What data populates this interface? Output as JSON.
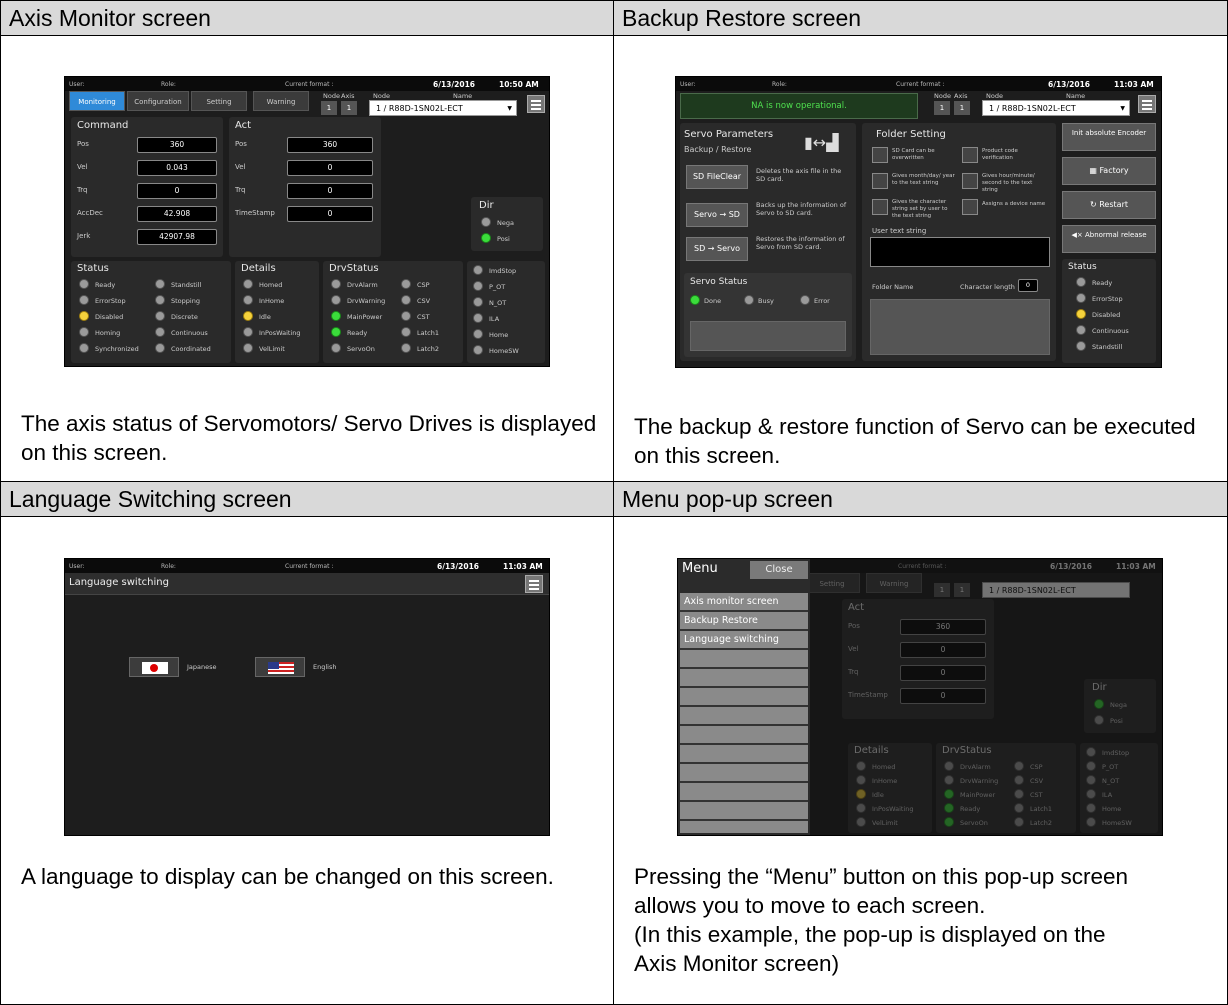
{
  "cells": {
    "axis_monitor": {
      "title": "Axis Monitor screen",
      "caption": "The axis status of Servomotors/ Servo Drives is displayed on this screen."
    },
    "backup_restore": {
      "title": "Backup Restore screen",
      "caption": "The backup & restore function of Servo can be executed on this screen."
    },
    "language": {
      "title": "Language Switching screen",
      "caption": "A language to display can be changed on this screen."
    },
    "menu": {
      "title": "Menu pop-up screen",
      "caption_lines": [
        "Pressing the “Menu” button on this pop-up screen",
        "allows you to move to each screen.",
        "(In this example, the pop-up is displayed on the",
        "Axis Monitor screen)"
      ]
    }
  },
  "hmi": {
    "topbar": {
      "user": "User:",
      "role": "Role:",
      "format": "Current format :"
    },
    "axis": {
      "date": "6/13/2016",
      "time": "10:50 AM",
      "tabs": [
        "Monitoring",
        "Configuration",
        "Setting",
        "Warning"
      ],
      "node_label": "Node",
      "axis_label": "Axis",
      "node2_label": "Node",
      "name_label": "Name",
      "node": "1",
      "axis": "1",
      "name": "1 / R88D-1SN02L-ECT",
      "command": {
        "title": "Command",
        "rows": [
          {
            "k": "Pos",
            "v": "360"
          },
          {
            "k": "Vel",
            "v": "0.043"
          },
          {
            "k": "Trq",
            "v": "0"
          },
          {
            "k": "AccDec",
            "v": "42.908"
          },
          {
            "k": "Jerk",
            "v": "42907.98"
          }
        ]
      },
      "act": {
        "title": "Act",
        "rows": [
          {
            "k": "Pos",
            "v": "360"
          },
          {
            "k": "Vel",
            "v": "0"
          },
          {
            "k": "Trq",
            "v": "0"
          },
          {
            "k": "TimeStamp",
            "v": "0"
          }
        ]
      },
      "dir": {
        "title": "Dir",
        "items": [
          "Nega",
          "Posi"
        ]
      },
      "status": {
        "title": "Status",
        "col1": [
          "Ready",
          "ErrorStop",
          "Disabled",
          "Homing",
          "Synchronized"
        ],
        "col2": [
          "Standstill",
          "Stopping",
          "Discrete",
          "Continuous",
          "Coordinated"
        ]
      },
      "details": {
        "title": "Details",
        "items": [
          "Homed",
          "InHome",
          "Idle",
          "InPosWaiting",
          "VelLimit"
        ]
      },
      "drv": {
        "title": "DrvStatus",
        "col1": [
          "DrvAlarm",
          "DrvWarning",
          "MainPower",
          "Ready",
          "ServoOn"
        ],
        "col2": [
          "CSP",
          "CSV",
          "CST",
          "Latch1",
          "Latch2"
        ]
      },
      "io": [
        "ImdStop",
        "P_OT",
        "N_OT",
        "ILA",
        "Home",
        "HomeSW"
      ]
    },
    "backup": {
      "date": "6/13/2016",
      "time": "11:03 AM",
      "message": "NA is now operational.",
      "servo_params_title": "Servo Parameters",
      "servo_params_sub": "Backup / Restore",
      "buttons": [
        {
          "label": "SD FileClear",
          "desc": "Deletes the axis file in the SD card."
        },
        {
          "label": "Servo → SD",
          "desc": "Backs up the information of Servo to SD card."
        },
        {
          "label": "SD → Servo",
          "desc": "Restores the information of Servo from SD card."
        }
      ],
      "servo_status_title": "Servo Status",
      "servo_status": [
        "Done",
        "Busy",
        "Error"
      ],
      "folder_title": "Folder Setting",
      "folder_opts": [
        "SD Card can be overwritten",
        "Product code verification",
        "Gives month/day/ year to the text string",
        "Gives hour/minute/ second to the text string",
        "Gives the character string set by user to the text string",
        "Assigns a device name"
      ],
      "user_text": "User text string",
      "folder_name": "Folder Name",
      "char_len": "Character length",
      "char_len_val": "0",
      "side_buttons": [
        "Init absolute Encoder",
        "Factory",
        "Restart",
        "Abnormal release"
      ],
      "status_title": "Status",
      "status_items": [
        "Ready",
        "ErrorStop",
        "Disabled",
        "Continuous",
        "Standstill"
      ]
    },
    "lang": {
      "date": "6/13/2016",
      "time": "11:03 AM",
      "title": "Language switching",
      "japanese": "Japanese",
      "english": "English"
    },
    "menu": {
      "date": "6/13/2016",
      "time": "11:03 AM",
      "menu_label": "Menu",
      "close_label": "Close",
      "items": [
        "Axis monitor screen",
        "Backup Restore",
        "Language switching"
      ]
    }
  },
  "colors": {
    "header_bg": "#d9d9d9",
    "tab_active": "#2f8ad8",
    "led_green": "#3bdc3b",
    "led_yellow": "#f5d23c"
  }
}
